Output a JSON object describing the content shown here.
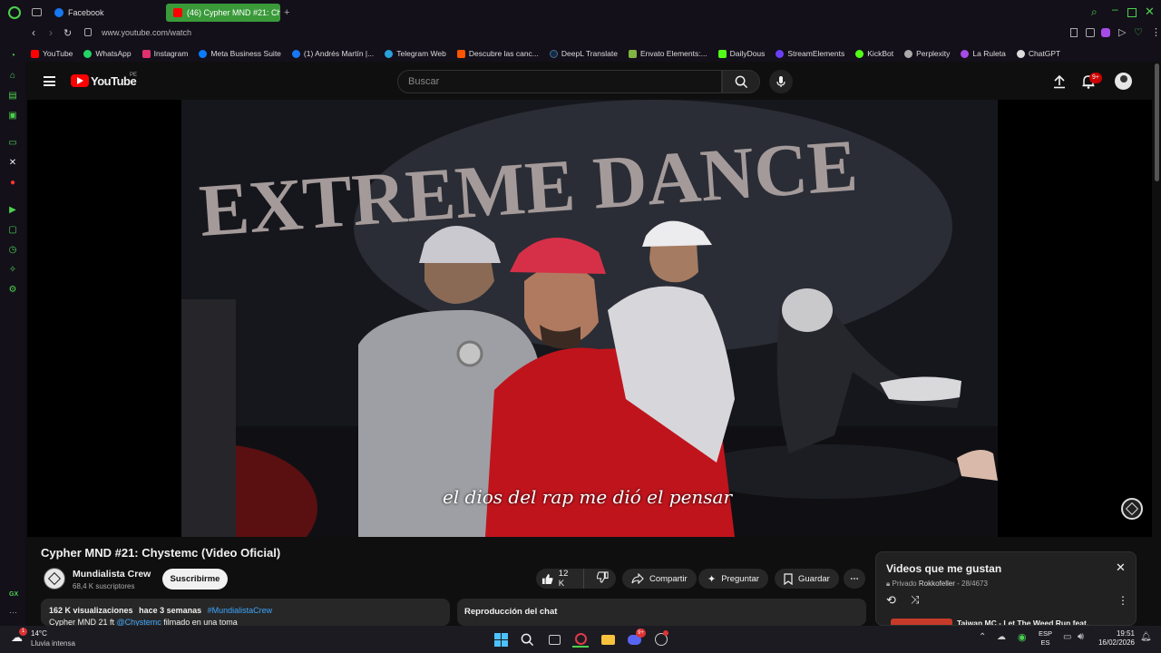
{
  "browser": {
    "tabs": [
      {
        "label": "Facebook",
        "color": "#1877f2"
      },
      {
        "label": "(46) Cypher MND #21: Chy",
        "color": "#ff0000"
      }
    ],
    "new_tab": "+",
    "url": "www.youtube.com/watch",
    "bookmarks": [
      {
        "label": "YouTube",
        "color": "#ff0000"
      },
      {
        "label": "WhatsApp",
        "color": "#25d366"
      },
      {
        "label": "Instagram",
        "color": "#e1306c"
      },
      {
        "label": "Meta Business Suite",
        "color": "#0a7cff"
      },
      {
        "label": "(1) Andrés Martín |...",
        "color": "#1877f2"
      },
      {
        "label": "Telegram Web",
        "color": "#2aa1da"
      },
      {
        "label": "Descubre las canc...",
        "color": "#ff5500"
      },
      {
        "label": "DeepL Translate",
        "color": "#0f2b46"
      },
      {
        "label": "Envato Elements:...",
        "color": "#82b541"
      },
      {
        "label": "DailyDous",
        "color": "#53fc18"
      },
      {
        "label": "StreamElements",
        "color": "#6b3ff5"
      },
      {
        "label": "KickBot",
        "color": "#53fc18"
      },
      {
        "label": "Perplexity",
        "color": "#aaaaaa"
      },
      {
        "label": "La Ruleta",
        "color": "#a64ce6"
      },
      {
        "label": "ChatGPT",
        "color": "#dddddd"
      }
    ]
  },
  "youtube": {
    "logo": "YouTube",
    "region": "PE",
    "search_placeholder": "Buscar",
    "notifications": "9+"
  },
  "video": {
    "subtitle": "el dios del rap me dió el pensar",
    "title": "Cypher MND #21: Chystemc (Video Oficial)",
    "channel": "Mundialista Crew",
    "subscribers": "68,4 K suscriptores",
    "subscribe": "Suscribirme",
    "likes": "12 K",
    "share": "Compartir",
    "ask": "Preguntar",
    "save": "Guardar",
    "views": "162 K visualizaciones",
    "age": "hace 3 semanas",
    "hashtag": "#MundialistaCrew",
    "desc_line": "Cypher MND 21 ft",
    "desc_mention": "@Chystemc",
    "desc_rest": "filmado en una toma",
    "chat_replay": "Reproducción del chat"
  },
  "playlist": {
    "title": "Videos que me gustan",
    "privacy": "Privado",
    "owner": "Rokkofeller",
    "position": "28/4673",
    "next_item": "Taiwan MC - Let The Weed Run feat."
  },
  "taskbar": {
    "temp": "14°C",
    "weather": "Lluvia intensa",
    "weather_badge": "1",
    "lang_top": "ESP",
    "lang_bottom": "ES",
    "time": "19:51",
    "date": "16/02/2026",
    "discord_badge": "9+"
  },
  "sidebar": {
    "gx_label": "GX"
  },
  "colors": {
    "accent": "#4cd14c",
    "youtube_red": "#ff0000",
    "background": "#0f0f0f"
  }
}
